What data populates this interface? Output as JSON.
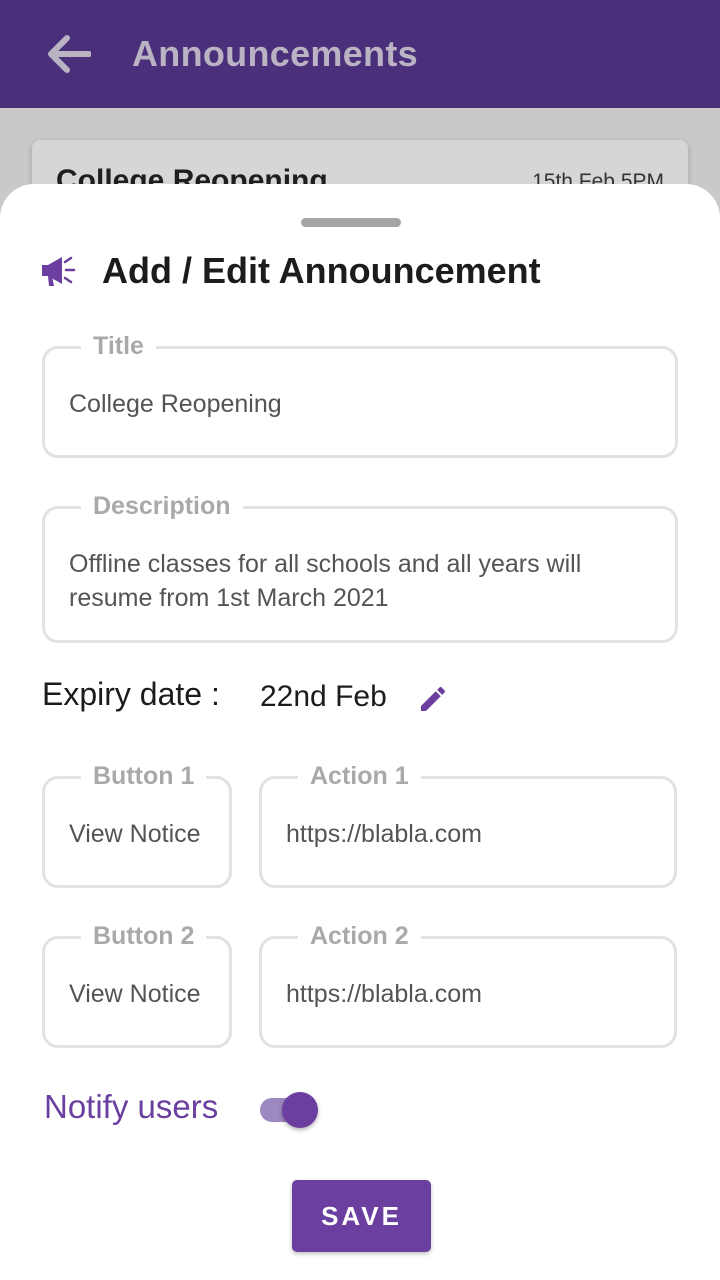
{
  "appbar": {
    "title": "Announcements",
    "back_icon": "arrow-left-icon"
  },
  "background_card": {
    "title": "College Reopening",
    "time": "15th Feb 5PM"
  },
  "sheet": {
    "header_icon": "megaphone-icon",
    "title": "Add / Edit Announcement",
    "fields": {
      "title": {
        "label": "Title",
        "value": "College Reopening"
      },
      "description": {
        "label": "Description",
        "value": "Offline classes for all schools and all years will resume from 1st March 2021"
      },
      "button1": {
        "label": "Button 1",
        "value": "View Notice"
      },
      "action1": {
        "label": "Action 1",
        "value": "https://blabla.com"
      },
      "button2": {
        "label": "Button 2",
        "value": "View Notice"
      },
      "action2": {
        "label": "Action 2",
        "value": "https://blabla.com"
      }
    },
    "expiry": {
      "label": "Expiry date :",
      "value": "22nd Feb",
      "edit_icon": "pencil-icon"
    },
    "notify": {
      "label": "Notify users",
      "enabled": true
    },
    "save_label": "SAVE"
  },
  "colors": {
    "appbar": "#4a2f7a",
    "accent": "#6a3fa0",
    "field_border": "#e2e2e2",
    "label_gray": "#a9a9a9"
  }
}
